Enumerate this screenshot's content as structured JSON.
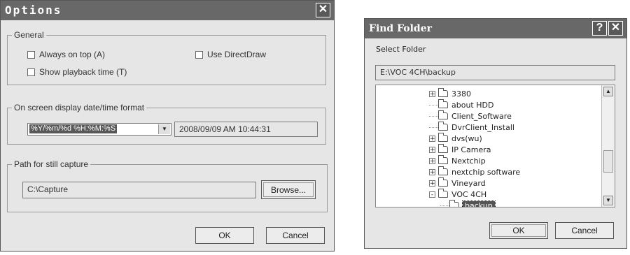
{
  "options": {
    "title": "Options",
    "general_legend": "General",
    "always_on_top": "Always on top (A)",
    "use_directdraw": "Use DirectDraw",
    "show_playback_time": "Show playback time (T)",
    "osd_legend": "On screen display date/time format",
    "format_value": "%Y/%m/%d %H:%M:%S",
    "format_preview": "2008/09/09 AM 10:44:31",
    "capture_legend": "Path for still capture",
    "capture_path": "C:\\Capture",
    "browse_label": "Browse...",
    "ok_label": "OK",
    "cancel_label": "Cancel"
  },
  "find_folder": {
    "title": "Find Folder",
    "prompt": "Select Folder",
    "path": "E:\\VOC 4CH\\backup",
    "tree": [
      {
        "label": "3380",
        "expander": "+"
      },
      {
        "label": "about  HDD",
        "expander": ""
      },
      {
        "label": "Client_Software",
        "expander": ""
      },
      {
        "label": "DvrClient_Install",
        "expander": ""
      },
      {
        "label": "dvs(wu)",
        "expander": "+"
      },
      {
        "label": "IP Camera",
        "expander": "+"
      },
      {
        "label": "Nextchip",
        "expander": "+"
      },
      {
        "label": "nextchip software",
        "expander": "+"
      },
      {
        "label": "Vineyard",
        "expander": "+"
      },
      {
        "label": "VOC 4CH",
        "expander": "-"
      },
      {
        "label": "backup",
        "expander": "",
        "selected": true
      }
    ],
    "ok_label": "OK",
    "cancel_label": "Cancel"
  }
}
